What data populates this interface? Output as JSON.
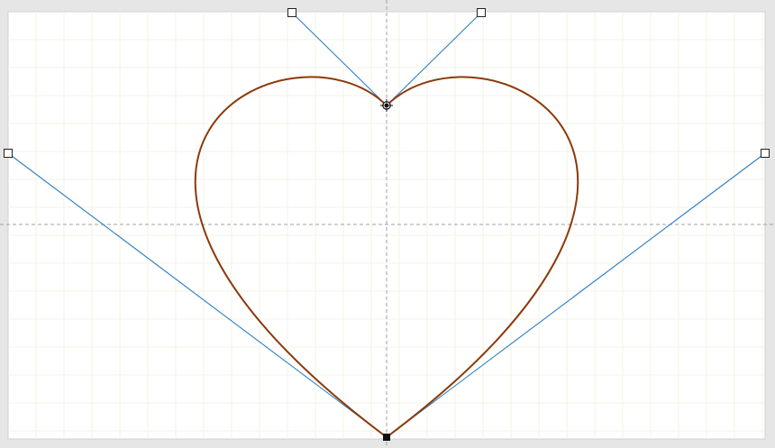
{
  "editor": {
    "curve_color": "#8b3a0a",
    "handle_color": "#2e7fc2",
    "guide_color": "#a0a0a0",
    "canvas_background": "#ffffff",
    "frame_background": "#e6e6e6",
    "grid": true
  },
  "icons": {
    "top_anchor": "move-crosshair-icon",
    "bottom_anchor": "square-anchor-icon",
    "handles": "square-handle-icon"
  }
}
